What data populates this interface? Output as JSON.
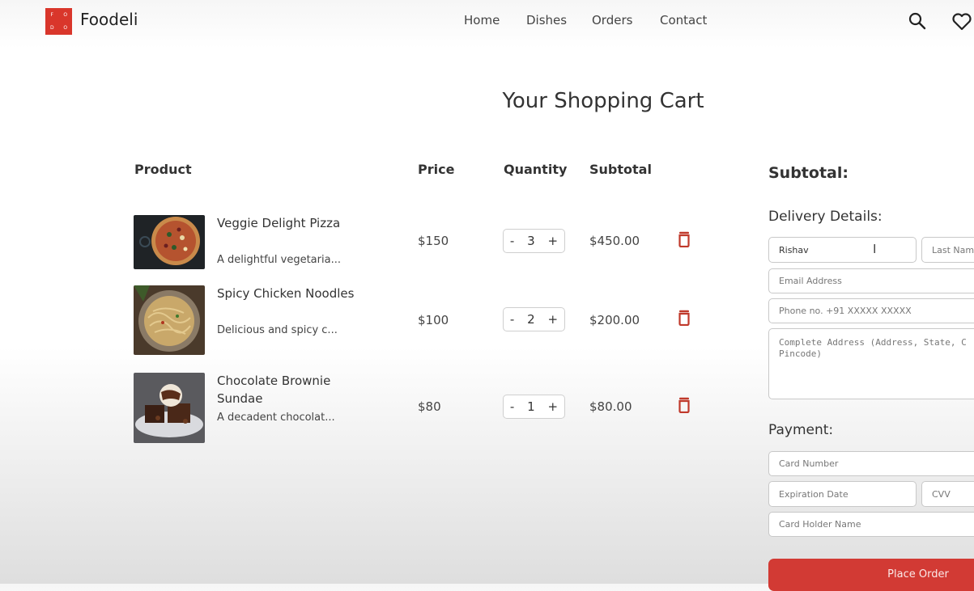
{
  "header": {
    "logo_letters": [
      "F",
      "O",
      "D",
      "O"
    ],
    "brand": "Foodeli",
    "nav": [
      "Home",
      "Dishes",
      "Orders",
      "Contact"
    ],
    "icons": [
      "search-icon",
      "heart-icon"
    ]
  },
  "page_title": "Your Shopping Cart",
  "table": {
    "headers": {
      "product": "Product",
      "price": "Price",
      "quantity": "Quantity",
      "subtotal": "Subtotal"
    },
    "rows": [
      {
        "name": "Veggie Delight Pizza",
        "desc": "A delightful vegetaria...",
        "price": "$150",
        "qty": "3",
        "subtotal": "$450.00"
      },
      {
        "name": "Spicy Chicken Noodles",
        "desc": "Delicious and spicy c...",
        "price": "$100",
        "qty": "2",
        "subtotal": "$200.00"
      },
      {
        "name": "Chocolate Brownie Sundae",
        "desc": "A decadent chocolat...",
        "price": "$80",
        "qty": "1",
        "subtotal": "$80.00"
      }
    ],
    "minus": "-",
    "plus": "+"
  },
  "summary": {
    "subtotal_label": "Subtotal:",
    "delivery_label": "Delivery Details:",
    "first_name_value": "Rishav",
    "last_name_placeholder": "Last Name",
    "email_placeholder": "Email Address",
    "phone_placeholder": "Phone no. +91 XXXXX XXXXX",
    "address_placeholder": "Complete Address (Address, State, C\nPincode)",
    "payment_label": "Payment:",
    "card_number_placeholder": "Card Number",
    "expiry_placeholder": "Expiration Date",
    "cvv_placeholder": "CVV",
    "holder_placeholder": "Card Holder Name",
    "place_order": "Place Order"
  },
  "colors": {
    "brand_red": "#d9362b",
    "trash_red": "#c0392b",
    "button_red": "#d23a34"
  }
}
